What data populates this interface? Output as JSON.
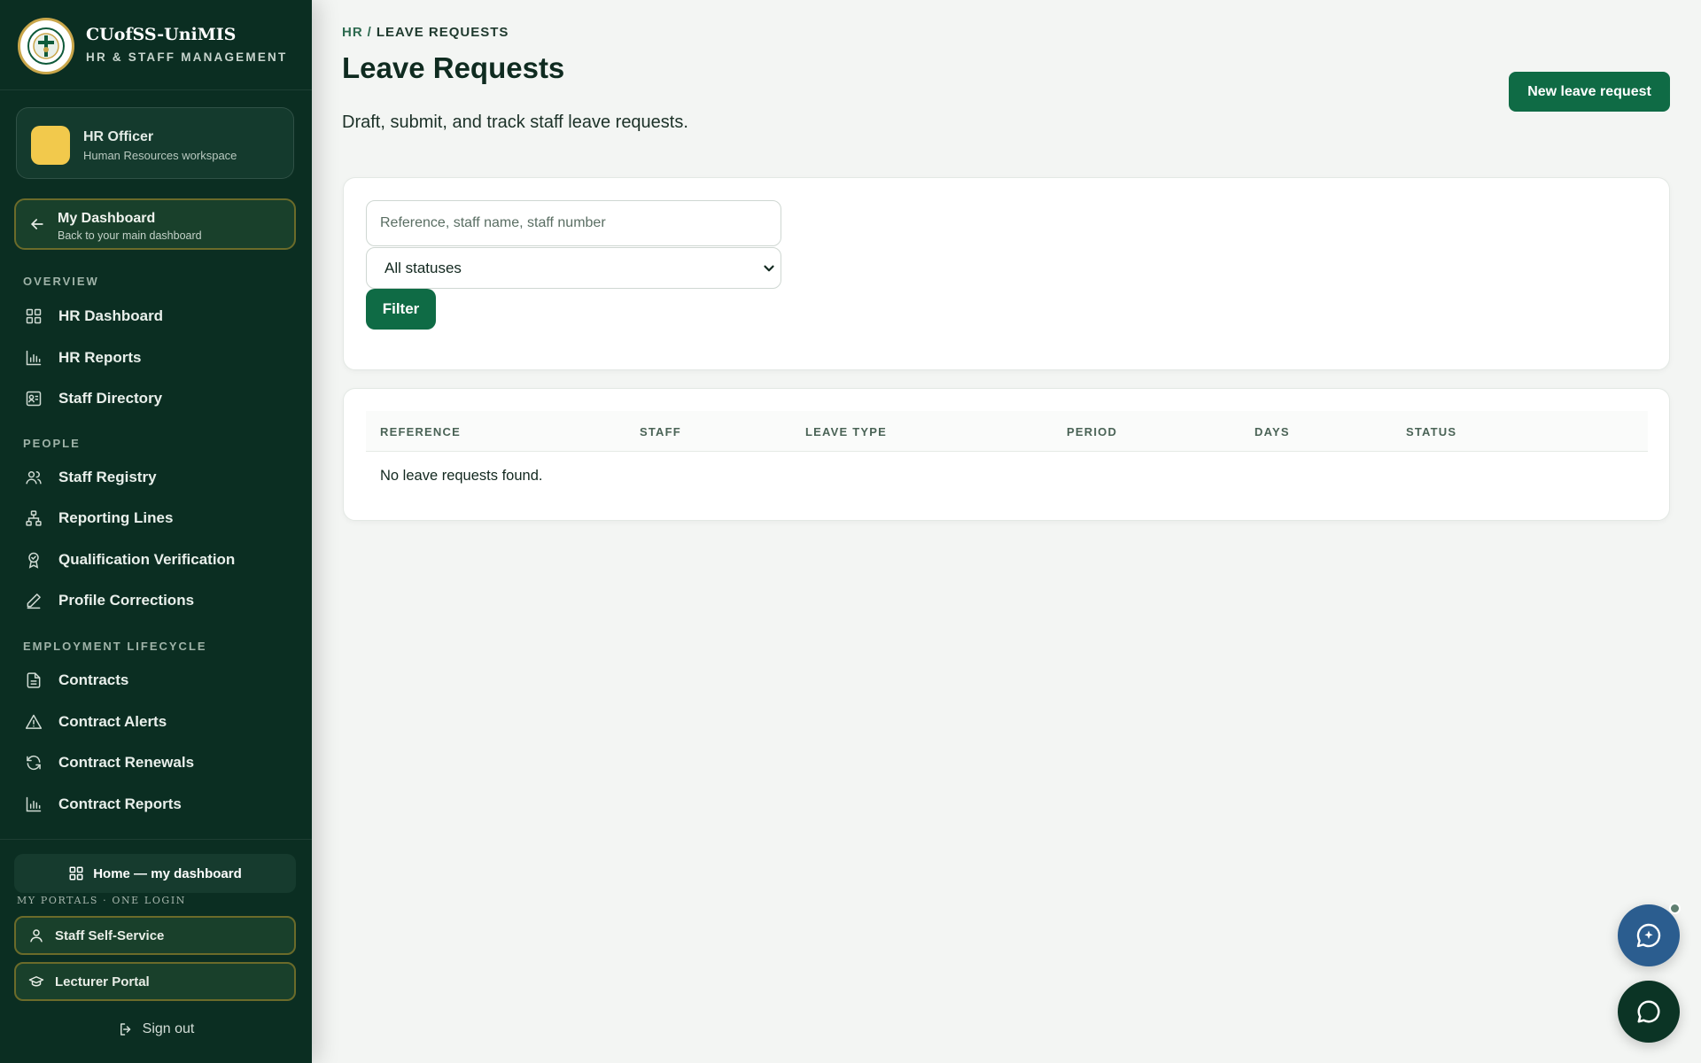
{
  "brand": {
    "name": "CUofSS-UniMIS",
    "subtitle": "HR & STAFF MANAGEMENT"
  },
  "role": {
    "title": "HR Officer",
    "subtitle": "Human Resources workspace"
  },
  "dashboard_button": {
    "title": "My Dashboard",
    "subtitle": "Back to your main dashboard"
  },
  "nav": {
    "overview": {
      "label": "OVERVIEW",
      "items": [
        {
          "label": "HR Dashboard",
          "icon": "grid-icon"
        },
        {
          "label": "HR Reports",
          "icon": "bar-chart-icon"
        },
        {
          "label": "Staff Directory",
          "icon": "contact-card-icon"
        }
      ]
    },
    "people": {
      "label": "PEOPLE",
      "items": [
        {
          "label": "Staff Registry",
          "icon": "users-icon"
        },
        {
          "label": "Reporting Lines",
          "icon": "org-chart-icon"
        },
        {
          "label": "Qualification Verification",
          "icon": "award-icon"
        },
        {
          "label": "Profile Corrections",
          "icon": "pencil-icon"
        }
      ]
    },
    "lifecycle": {
      "label": "EMPLOYMENT LIFECYCLE",
      "items": [
        {
          "label": "Contracts",
          "icon": "document-icon"
        },
        {
          "label": "Contract Alerts",
          "icon": "warning-icon"
        },
        {
          "label": "Contract Renewals",
          "icon": "refresh-icon"
        },
        {
          "label": "Contract Reports",
          "icon": "bar-chart-icon"
        }
      ]
    }
  },
  "footer": {
    "home_label": "Home — my dashboard",
    "portals_label": "MY PORTALS · ONE LOGIN",
    "portals": [
      {
        "label": "Staff Self-Service",
        "icon": "user-icon"
      },
      {
        "label": "Lecturer Portal",
        "icon": "graduation-cap-icon"
      }
    ],
    "signout_label": "Sign out"
  },
  "breadcrumb": {
    "root": "HR",
    "separator": "/",
    "current": "LEAVE REQUESTS"
  },
  "page": {
    "title": "Leave Requests",
    "description": "Draft, submit, and track staff leave requests.",
    "new_button": "New leave request"
  },
  "filters": {
    "search_placeholder": "Reference, staff name, staff number",
    "search_value": "",
    "status_selected": "All statuses",
    "filter_button": "Filter"
  },
  "table": {
    "columns": [
      "REFERENCE",
      "STAFF",
      "LEAVE TYPE",
      "PERIOD",
      "DAYS",
      "STATUS"
    ],
    "rows": [],
    "empty_message": "No leave requests found."
  },
  "colors": {
    "sidebar_bg": "#0b2e22",
    "primary": "#0f6b45",
    "accent_border": "#6b6b2a",
    "avatar": "#f2c94c",
    "ai_fab": "#2b5d8f",
    "chat_fab": "#0b3425"
  }
}
